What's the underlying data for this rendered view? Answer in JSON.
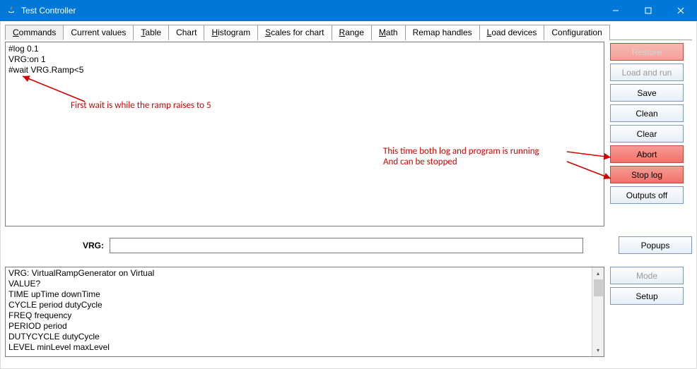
{
  "window": {
    "title": "Test Controller"
  },
  "tabs": [
    {
      "label": "Commands",
      "mn": "C"
    },
    {
      "label": "Current values",
      "mn": ""
    },
    {
      "label": "Table",
      "mn": "T"
    },
    {
      "label": "Chart",
      "mn": ""
    },
    {
      "label": "Histogram",
      "mn": "H"
    },
    {
      "label": "Scales for chart",
      "mn": "S"
    },
    {
      "label": "Range",
      "mn": "R"
    },
    {
      "label": "Math",
      "mn": "M"
    },
    {
      "label": "Remap handles",
      "mn": ""
    },
    {
      "label": "Load devices",
      "mn": "L"
    },
    {
      "label": "Configuration",
      "mn": ""
    }
  ],
  "code": "#log 0.1\nVRG:on 1\n#wait VRG.Ramp<5",
  "buttons": {
    "restore": "Restore",
    "load_run": "Load and run",
    "save": "Save",
    "clean": "Clean",
    "clear": "Clear",
    "abort": "Abort",
    "stop_log": "Stop log",
    "outputs_off": "Outputs off",
    "popups": "Popups",
    "mode": "Mode",
    "setup": "Setup"
  },
  "input": {
    "label": "VRG:",
    "value": ""
  },
  "log": "VRG: VirtualRampGenerator on Virtual\nVALUE?\nTIME upTime downTime\nCYCLE period dutyCycle\nFREQ frequency\nPERIOD period\nDUTYCYCLE dutyCycle\nLEVEL minLevel maxLevel",
  "annotations": {
    "a1": "First wait is while the ramp raises to 5",
    "a2_line1": "This time both log and program is running",
    "a2_line2": "And can be stopped"
  }
}
